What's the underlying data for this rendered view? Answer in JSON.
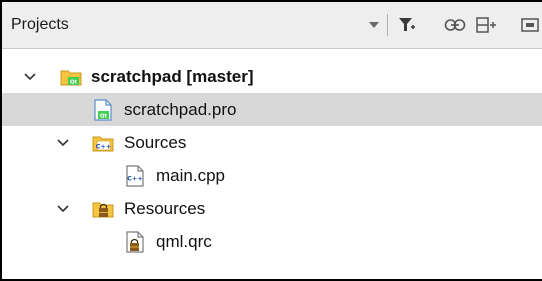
{
  "panel": {
    "title": "Projects",
    "toolbar": [
      {
        "name": "dropdown-arrow-icon"
      },
      {
        "name": "filter-icon"
      },
      {
        "name": "link-icon"
      },
      {
        "name": "split-add-icon"
      },
      {
        "name": "close-split-icon"
      }
    ]
  },
  "tree": {
    "project": {
      "label": "scratchpad [master]",
      "icon": "qt-project-folder-icon",
      "expanded": true
    },
    "pro_file": {
      "label": "scratchpad.pro",
      "icon": "qt-pro-file-icon",
      "selected": true
    },
    "sources": {
      "label": "Sources",
      "icon": "cpp-folder-icon",
      "expanded": true
    },
    "main_cpp": {
      "label": "main.cpp",
      "icon": "cpp-file-icon"
    },
    "resources": {
      "label": "Resources",
      "icon": "resource-folder-icon",
      "expanded": true
    },
    "qml_qrc": {
      "label": "qml.qrc",
      "icon": "qrc-file-icon"
    }
  },
  "colors": {
    "header_bg": "#eeeeee",
    "selection_bg": "#d8d8d8",
    "folder_yellow": "#f5c542",
    "qt_green": "#41cd52"
  }
}
